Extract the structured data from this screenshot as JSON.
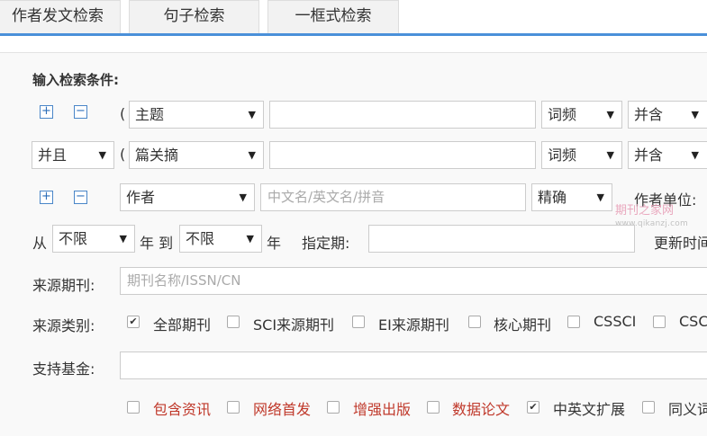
{
  "tabs": [
    {
      "label": "作者发文检索"
    },
    {
      "label": "句子检索"
    },
    {
      "label": "一框式检索"
    }
  ],
  "form": {
    "heading": "输入检索条件:",
    "row1": {
      "paren": "(",
      "field": "主题",
      "freq": "词频",
      "logic": "并含"
    },
    "row2": {
      "bool": "并且",
      "paren": "(",
      "field": "篇关摘",
      "freq": "词频",
      "logic": "并含"
    },
    "row3": {
      "field": "作者",
      "placeholder": "中文名/英文名/拼音",
      "match": "精确",
      "unit_label": "作者单位:"
    },
    "row4": {
      "from": "从",
      "from_sel": "不限",
      "year_to": "年 到",
      "to_sel": "不限",
      "year": "年",
      "period_label": "指定期:",
      "update_label": "更新时间"
    },
    "source_journal": {
      "label": "来源期刊:",
      "placeholder": "期刊名称/ISSN/CN"
    },
    "source_category": {
      "label": "来源类别:",
      "options": [
        {
          "label": "全部期刊",
          "checked": true
        },
        {
          "label": "SCI来源期刊",
          "checked": false
        },
        {
          "label": "EI来源期刊",
          "checked": false
        },
        {
          "label": "核心期刊",
          "checked": false
        },
        {
          "label": "CSSCI",
          "checked": false
        },
        {
          "label": "CSCD",
          "checked": false
        }
      ]
    },
    "fund": {
      "label": "支持基金:"
    },
    "extra_options": [
      {
        "label": "包含资讯",
        "checked": false
      },
      {
        "label": "网络首发",
        "checked": false
      },
      {
        "label": "增强出版",
        "checked": false
      },
      {
        "label": "数据论文",
        "checked": false
      },
      {
        "label": "中英文扩展",
        "checked": true
      },
      {
        "label": "同义词扩展",
        "checked": false
      }
    ]
  },
  "watermark": {
    "text": "期刊之家网",
    "url": "www.qikanzj.com"
  }
}
